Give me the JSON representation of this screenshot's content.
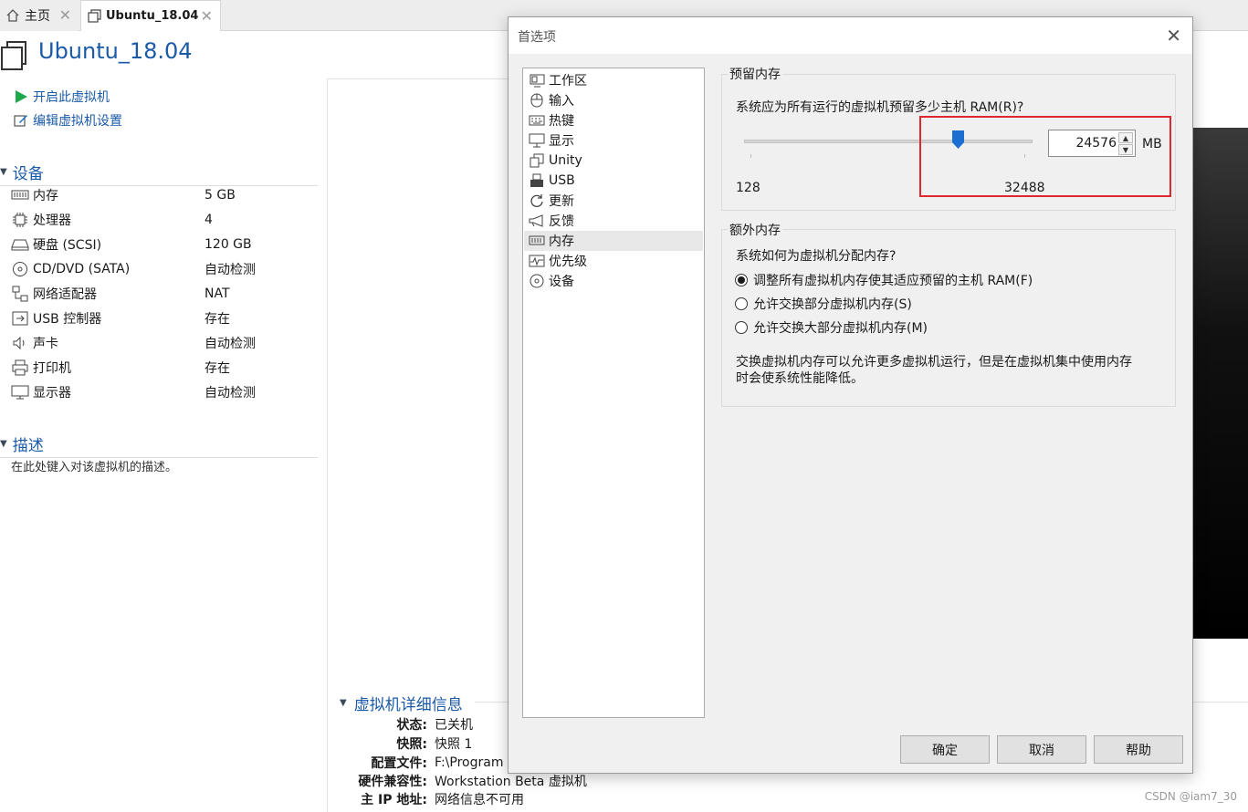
{
  "tabs": [
    {
      "label": "主页",
      "icon": "home-icon"
    },
    {
      "label": "Ubuntu_18.04",
      "icon": "vm-icon"
    }
  ],
  "vm": {
    "title": "Ubuntu_18.04",
    "actions": [
      "开启此虚拟机",
      "编辑虚拟机设置"
    ],
    "devices_heading": "设备",
    "devices": [
      {
        "name": "内存",
        "value": "5 GB",
        "icon": "memory-icon"
      },
      {
        "name": "处理器",
        "value": "4",
        "icon": "cpu-icon"
      },
      {
        "name": "硬盘 (SCSI)",
        "value": "120 GB",
        "icon": "hard-disk-icon"
      },
      {
        "name": "CD/DVD (SATA)",
        "value": "自动检测",
        "icon": "cd-dvd-icon"
      },
      {
        "name": "网络适配器",
        "value": "NAT",
        "icon": "network-adapter-icon"
      },
      {
        "name": "USB 控制器",
        "value": "存在",
        "icon": "usb-icon"
      },
      {
        "name": "声卡",
        "value": "自动检测",
        "icon": "sound-card-icon"
      },
      {
        "name": "打印机",
        "value": "存在",
        "icon": "printer-icon"
      },
      {
        "name": "显示器",
        "value": "自动检测",
        "icon": "display-icon"
      }
    ],
    "description_heading": "描述",
    "description_placeholder": "在此处键入对该虚拟机的描述。",
    "details_heading": "虚拟机详细信息",
    "details": [
      {
        "key": "状态:",
        "value": "已关机"
      },
      {
        "key": "快照:",
        "value": "快照 1"
      },
      {
        "key": "配置文件:",
        "value": "F:\\Program"
      },
      {
        "key": "硬件兼容性:",
        "value": "Workstation Beta 虚拟机"
      },
      {
        "key": "主 IP 地址:",
        "value": "网络信息不可用"
      }
    ]
  },
  "dialog": {
    "title": "首选项",
    "close": "✕",
    "nav": [
      {
        "label": "工作区",
        "icon": "workspace-icon"
      },
      {
        "label": "输入",
        "icon": "mouse-icon"
      },
      {
        "label": "热键",
        "icon": "keyboard-icon"
      },
      {
        "label": "显示",
        "icon": "monitor-icon"
      },
      {
        "label": "Unity",
        "icon": "unity-icon"
      },
      {
        "label": "USB",
        "icon": "usb-icon"
      },
      {
        "label": "更新",
        "icon": "refresh-icon"
      },
      {
        "label": "反馈",
        "icon": "feedback-icon"
      },
      {
        "label": "内存",
        "icon": "memory-icon",
        "selected": true
      },
      {
        "label": "优先级",
        "icon": "priority-icon"
      },
      {
        "label": "设备",
        "icon": "device-icon"
      }
    ],
    "reserved": {
      "group_label": "预留内存",
      "question": "系统应为所有运行的虚拟机预留多少主机 RAM(R)?",
      "value": "24576",
      "unit": "MB",
      "min_label": "128",
      "max_label": "32488",
      "slider_fraction": 0.756
    },
    "extra": {
      "group_label": "额外内存",
      "question": "系统如何为虚拟机分配内存?",
      "options": [
        {
          "label": "调整所有虚拟机内存使其适应预留的主机 RAM(F)",
          "checked": true
        },
        {
          "label": "允许交换部分虚拟机内存(S)",
          "checked": false
        },
        {
          "label": "允许交换大部分虚拟机内存(M)",
          "checked": false
        }
      ],
      "note_line1": "交换虚拟机内存可以允许更多虚拟机运行，但是在虚拟机集中使用内存",
      "note_line2": "时会使系统性能降低。"
    },
    "buttons": {
      "ok": "确定",
      "cancel": "取消",
      "help": "帮助"
    }
  },
  "watermark": "CSDN @iam7_30"
}
